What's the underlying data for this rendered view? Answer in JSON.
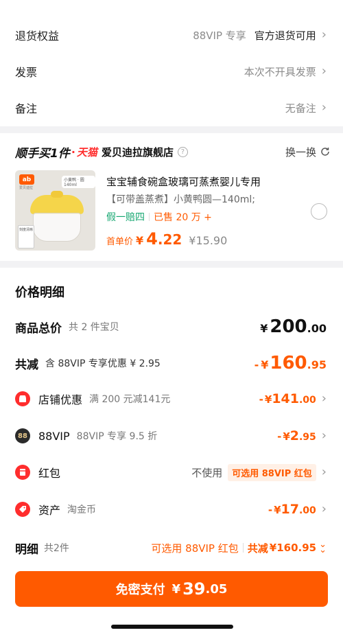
{
  "settings": {
    "return": {
      "label": "退货权益",
      "tag": "88VIP 专享",
      "value": "官方退货可用"
    },
    "invoice": {
      "label": "发票",
      "value": "本次不开具发票"
    },
    "note": {
      "label": "备注",
      "value": "无备注"
    }
  },
  "shop": {
    "badge_a": "顺手买1件",
    "badge_dot": "·",
    "badge_b": "天猫",
    "name": "爱贝迪拉旗舰店",
    "help": "?",
    "swap": "换一换"
  },
  "product": {
    "thumb_brand": "ab",
    "thumb_brand_sub": "爱贝迪拉",
    "thumb_tag": "小黄鸭 · 圆140ml",
    "thumb_side": "刻度清晰",
    "title": "宝宝辅食碗盒玻璃可蒸煮婴儿专用",
    "spec": "【可带盖蒸煮】小黄鸭圆—140ml;",
    "guarantee": "假一赔四",
    "sold": "已售 20 万 +",
    "price_label": "首单价",
    "price_symbol": "¥",
    "price_int": "4",
    "price_dec": ".22",
    "orig_price": "¥15.90"
  },
  "detail": {
    "title": "价格明细",
    "total": {
      "label": "商品总价",
      "sub": "共 2 件宝贝",
      "sym": "¥",
      "int": "200",
      "dec": ".00"
    },
    "reduce": {
      "label": "共减",
      "sub": "含 88VIP 专享优惠 ¥ 2.95",
      "sign": "-",
      "sym": "¥",
      "int": "160",
      "dec": ".95"
    },
    "items": [
      {
        "icon_text": "",
        "label": "店铺优惠",
        "sub": "满 200 元减141元",
        "sign": "-",
        "sym": "¥",
        "int": "141",
        "dec": ".00"
      },
      {
        "icon_text": "88",
        "label": "88VIP",
        "sub": "88VIP 专享 9.5 折",
        "sign": "-",
        "sym": "¥",
        "int": "2",
        "dec": ".95"
      },
      {
        "icon_text": "",
        "label": "红包",
        "sub": "",
        "not_use": "不使用",
        "tag": "可选用 88VIP 红包"
      },
      {
        "icon_text": "",
        "label": "资产",
        "sub": "淘金币",
        "sign": "-",
        "sym": "¥",
        "int": "17",
        "dec": ".00"
      }
    ]
  },
  "footer": {
    "label": "明细",
    "count": "共2件",
    "promo": "可选用 88VIP 红包",
    "total_label": "共减",
    "total_value": "¥160.95",
    "pay_label": "免密支付",
    "pay_sym": "¥",
    "pay_int": "39",
    "pay_dec": ".05"
  },
  "colors": {
    "accent": "#ff5a00",
    "pay_button": "#ff5a00",
    "red_icon": "#ff2d2d",
    "green": "#13a66f"
  }
}
